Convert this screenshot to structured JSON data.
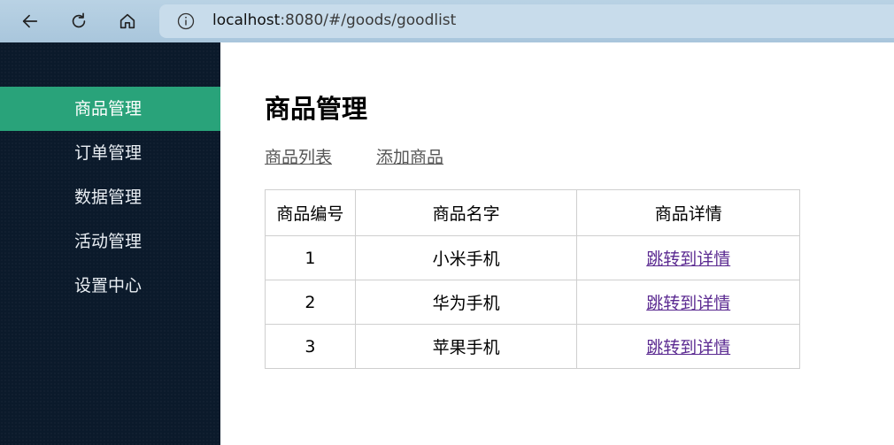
{
  "browser": {
    "url_host": "localhost",
    "url_rest": ":8080/#/goods/goodlist"
  },
  "sidebar": {
    "items": [
      {
        "label": "商品管理",
        "active": true
      },
      {
        "label": "订单管理",
        "active": false
      },
      {
        "label": "数据管理",
        "active": false
      },
      {
        "label": "活动管理",
        "active": false
      },
      {
        "label": "设置中心",
        "active": false
      }
    ]
  },
  "main": {
    "title": "商品管理",
    "tabs": [
      {
        "label": "商品列表"
      },
      {
        "label": "添加商品"
      }
    ],
    "table": {
      "headers": [
        "商品编号",
        "商品名字",
        "商品详情"
      ],
      "rows": [
        {
          "id": "1",
          "name": "小米手机",
          "detail": "跳转到详情"
        },
        {
          "id": "2",
          "name": "华为手机",
          "detail": "跳转到详情"
        },
        {
          "id": "3",
          "name": "苹果手机",
          "detail": "跳转到详情"
        }
      ]
    }
  },
  "colors": {
    "sidebar_bg": "#0b1a2b",
    "active_item": "#29a37a",
    "link_visited": "#5b2a91"
  },
  "icons": [
    "back-arrow-icon",
    "refresh-icon",
    "home-icon",
    "info-icon"
  ]
}
